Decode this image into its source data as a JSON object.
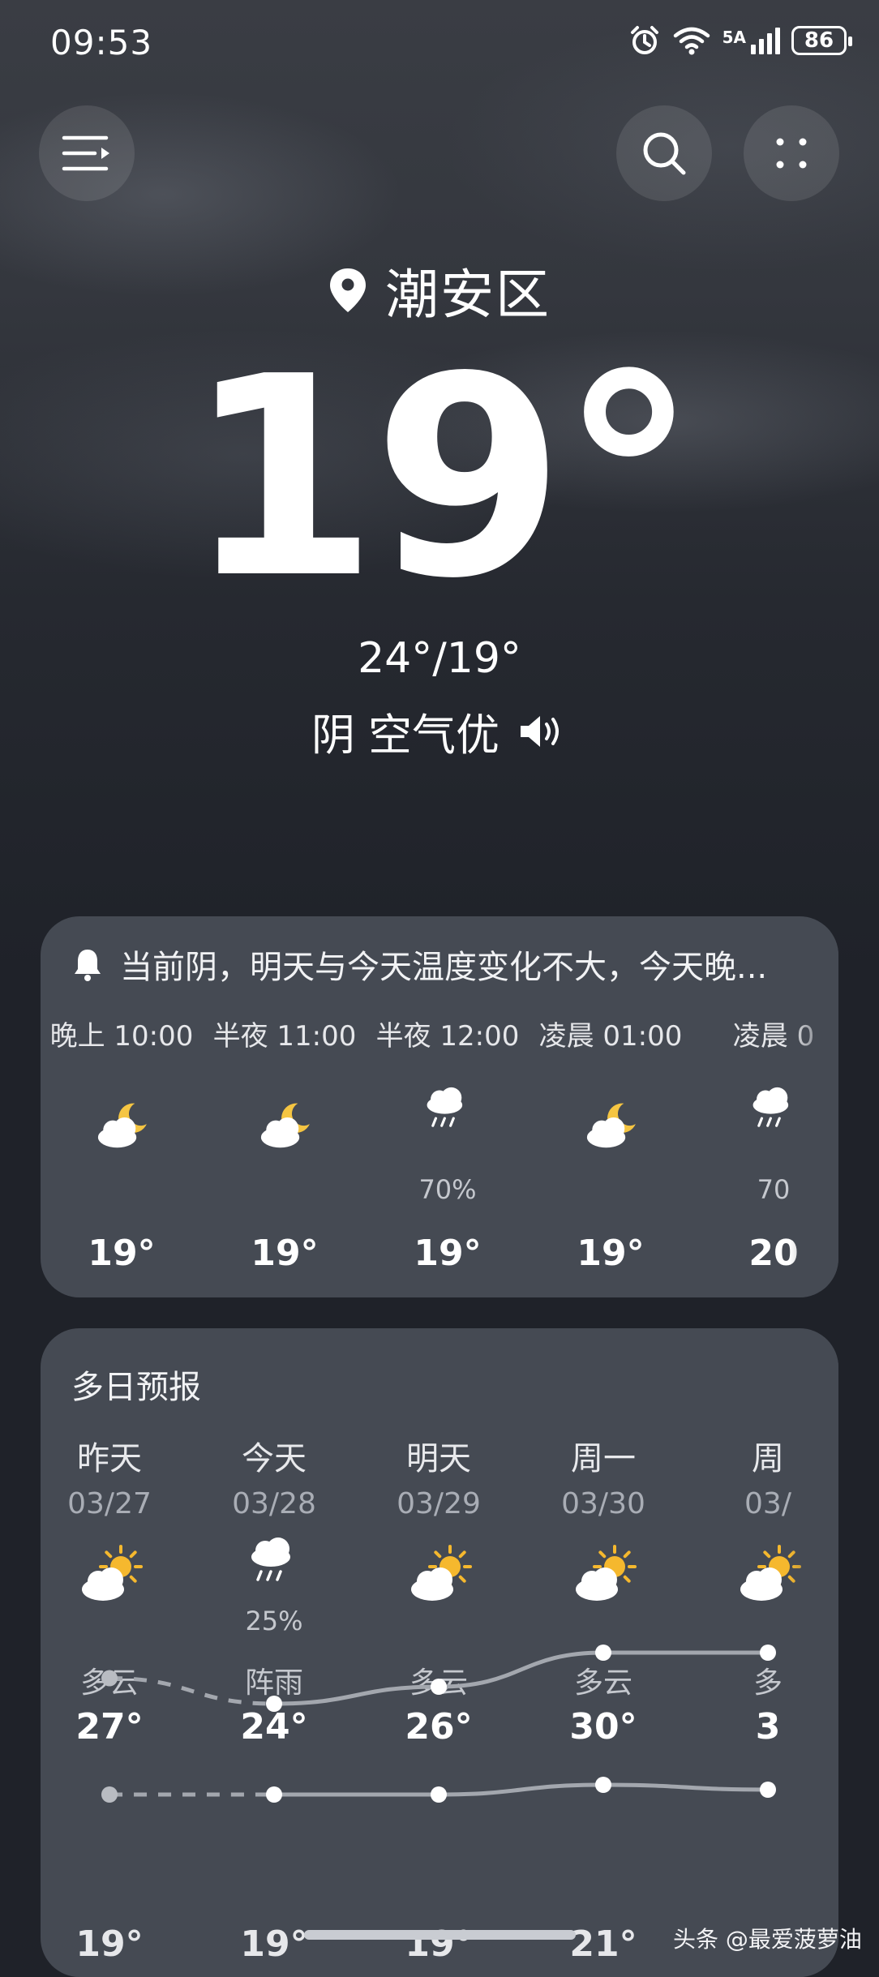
{
  "status": {
    "time": "09:53",
    "network": "5A",
    "battery": "86"
  },
  "location": {
    "name": "潮安区"
  },
  "current": {
    "temp": "19°",
    "hilo": "24°/19°",
    "condition": "阴",
    "air": "空气优"
  },
  "hourly_card": {
    "alert_text": "当前阴，明天与今天温度变化不大，今天晚...",
    "hours": [
      {
        "label": "晚上 10:00",
        "icon": "moon-cloud-icon",
        "pop": "",
        "temp": "19°"
      },
      {
        "label": "半夜 11:00",
        "icon": "moon-cloud-icon",
        "pop": "",
        "temp": "19°"
      },
      {
        "label": "半夜 12:00",
        "icon": "rain-cloud-icon",
        "pop": "70%",
        "temp": "19°"
      },
      {
        "label": "凌晨 01:00",
        "icon": "moon-cloud-icon",
        "pop": "",
        "temp": "19°"
      },
      {
        "label": "凌晨 0",
        "icon": "rain-cloud-icon",
        "pop": "70",
        "temp": "20"
      }
    ]
  },
  "daily_card": {
    "title": "多日预报",
    "days": [
      {
        "name": "昨天",
        "date": "03/27",
        "icon": "sun-cloud-icon",
        "pop": "",
        "cond": "多云",
        "hi": "27°",
        "hi_val": 27,
        "lo": "19°",
        "lo_val": 19
      },
      {
        "name": "今天",
        "date": "03/28",
        "icon": "rain-cloud-icon",
        "pop": "25%",
        "cond": "阵雨",
        "hi": "24°",
        "hi_val": 24,
        "lo": "19°",
        "lo_val": 19
      },
      {
        "name": "明天",
        "date": "03/29",
        "icon": "sun-cloud-icon",
        "pop": "",
        "cond": "多云",
        "hi": "26°",
        "hi_val": 26,
        "lo": "19°",
        "lo_val": 19
      },
      {
        "name": "周一",
        "date": "03/30",
        "icon": "sun-cloud-icon",
        "pop": "",
        "cond": "多云",
        "hi": "30°",
        "hi_val": 30,
        "lo": "21°",
        "lo_val": 21
      },
      {
        "name": "周",
        "date": "03/",
        "icon": "sun-cloud-icon",
        "pop": "",
        "cond": "多",
        "hi": "3",
        "hi_val": 30,
        "lo": "",
        "lo_val": 20
      }
    ]
  },
  "watermark": "头条 @最爱菠萝油",
  "colors": {
    "background": "#1f2229",
    "card": "#454a53",
    "moon": "#f5c542",
    "sun": "#f5b82e"
  }
}
